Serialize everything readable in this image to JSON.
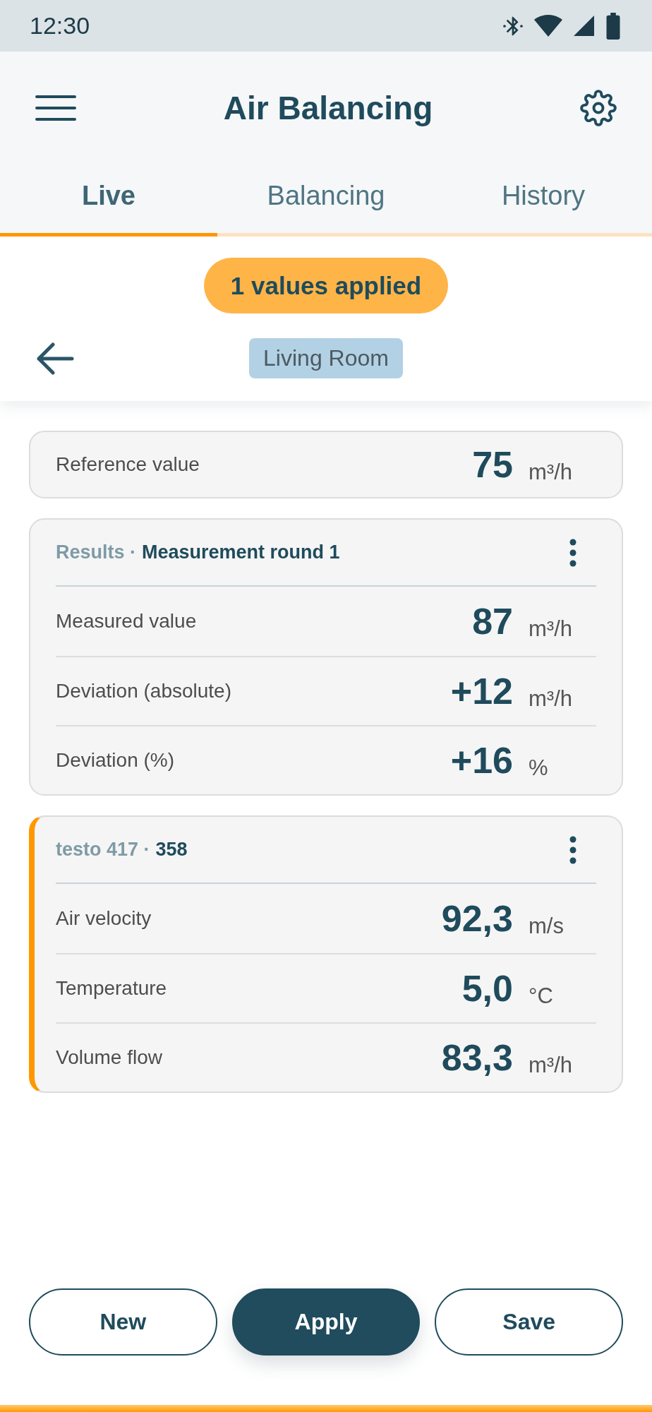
{
  "status_bar": {
    "time": "12:30"
  },
  "app_bar": {
    "title": "Air Balancing"
  },
  "tabs": [
    {
      "label": "Live",
      "selected": true
    },
    {
      "label": "Balancing",
      "selected": false
    },
    {
      "label": "History",
      "selected": false
    }
  ],
  "banner": {
    "text": "1 values applied"
  },
  "location": {
    "label": "Living Room"
  },
  "reference": {
    "label": "Reference value",
    "value": "75",
    "unit": "m³/h"
  },
  "cards": [
    {
      "source": "Results",
      "separator": "·",
      "title": "Measurement round 1",
      "highlighted": false,
      "rows": [
        {
          "label": "Measured value",
          "value": "87",
          "unit": "m³/h"
        },
        {
          "label": "Deviation (absolute)",
          "value": "+12",
          "unit": "m³/h"
        },
        {
          "label": "Deviation (%)",
          "value": "+16",
          "unit": "%"
        }
      ]
    },
    {
      "source": "testo 417",
      "separator": "·",
      "title": "358",
      "highlighted": true,
      "rows": [
        {
          "label": "Air velocity",
          "value": "92,3",
          "unit": "m/s"
        },
        {
          "label": "Temperature",
          "value": "5,0",
          "unit": "°C"
        },
        {
          "label": "Volume flow",
          "value": "83,3",
          "unit": "m³/h"
        }
      ]
    }
  ],
  "buttons": [
    {
      "label": "New",
      "kind": "outlined"
    },
    {
      "label": "Apply",
      "kind": "filled"
    },
    {
      "label": "Save",
      "kind": "outlined"
    }
  ]
}
